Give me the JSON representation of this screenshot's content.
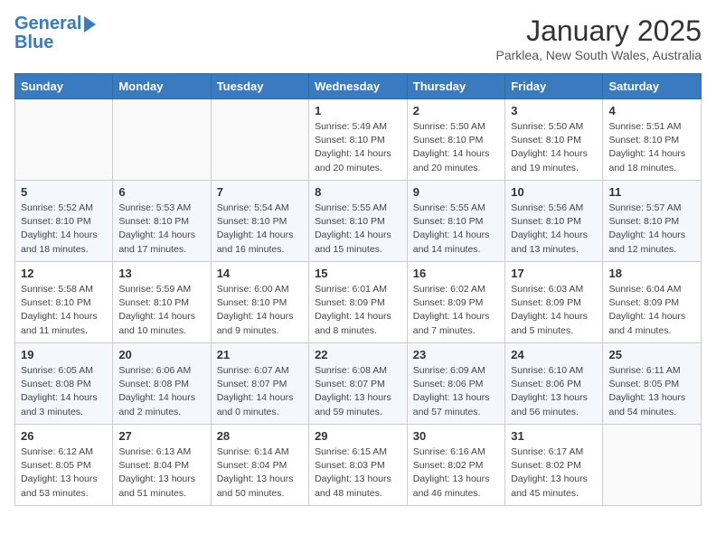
{
  "header": {
    "logo_line1": "General",
    "logo_line2": "Blue",
    "month": "January 2025",
    "location": "Parklea, New South Wales, Australia"
  },
  "weekdays": [
    "Sunday",
    "Monday",
    "Tuesday",
    "Wednesday",
    "Thursday",
    "Friday",
    "Saturday"
  ],
  "weeks": [
    [
      {
        "day": "",
        "info": ""
      },
      {
        "day": "",
        "info": ""
      },
      {
        "day": "",
        "info": ""
      },
      {
        "day": "1",
        "info": "Sunrise: 5:49 AM\nSunset: 8:10 PM\nDaylight: 14 hours\nand 20 minutes."
      },
      {
        "day": "2",
        "info": "Sunrise: 5:50 AM\nSunset: 8:10 PM\nDaylight: 14 hours\nand 20 minutes."
      },
      {
        "day": "3",
        "info": "Sunrise: 5:50 AM\nSunset: 8:10 PM\nDaylight: 14 hours\nand 19 minutes."
      },
      {
        "day": "4",
        "info": "Sunrise: 5:51 AM\nSunset: 8:10 PM\nDaylight: 14 hours\nand 18 minutes."
      }
    ],
    [
      {
        "day": "5",
        "info": "Sunrise: 5:52 AM\nSunset: 8:10 PM\nDaylight: 14 hours\nand 18 minutes."
      },
      {
        "day": "6",
        "info": "Sunrise: 5:53 AM\nSunset: 8:10 PM\nDaylight: 14 hours\nand 17 minutes."
      },
      {
        "day": "7",
        "info": "Sunrise: 5:54 AM\nSunset: 8:10 PM\nDaylight: 14 hours\nand 16 minutes."
      },
      {
        "day": "8",
        "info": "Sunrise: 5:55 AM\nSunset: 8:10 PM\nDaylight: 14 hours\nand 15 minutes."
      },
      {
        "day": "9",
        "info": "Sunrise: 5:55 AM\nSunset: 8:10 PM\nDaylight: 14 hours\nand 14 minutes."
      },
      {
        "day": "10",
        "info": "Sunrise: 5:56 AM\nSunset: 8:10 PM\nDaylight: 14 hours\nand 13 minutes."
      },
      {
        "day": "11",
        "info": "Sunrise: 5:57 AM\nSunset: 8:10 PM\nDaylight: 14 hours\nand 12 minutes."
      }
    ],
    [
      {
        "day": "12",
        "info": "Sunrise: 5:58 AM\nSunset: 8:10 PM\nDaylight: 14 hours\nand 11 minutes."
      },
      {
        "day": "13",
        "info": "Sunrise: 5:59 AM\nSunset: 8:10 PM\nDaylight: 14 hours\nand 10 minutes."
      },
      {
        "day": "14",
        "info": "Sunrise: 6:00 AM\nSunset: 8:10 PM\nDaylight: 14 hours\nand 9 minutes."
      },
      {
        "day": "15",
        "info": "Sunrise: 6:01 AM\nSunset: 8:09 PM\nDaylight: 14 hours\nand 8 minutes."
      },
      {
        "day": "16",
        "info": "Sunrise: 6:02 AM\nSunset: 8:09 PM\nDaylight: 14 hours\nand 7 minutes."
      },
      {
        "day": "17",
        "info": "Sunrise: 6:03 AM\nSunset: 8:09 PM\nDaylight: 14 hours\nand 5 minutes."
      },
      {
        "day": "18",
        "info": "Sunrise: 6:04 AM\nSunset: 8:09 PM\nDaylight: 14 hours\nand 4 minutes."
      }
    ],
    [
      {
        "day": "19",
        "info": "Sunrise: 6:05 AM\nSunset: 8:08 PM\nDaylight: 14 hours\nand 3 minutes."
      },
      {
        "day": "20",
        "info": "Sunrise: 6:06 AM\nSunset: 8:08 PM\nDaylight: 14 hours\nand 2 minutes."
      },
      {
        "day": "21",
        "info": "Sunrise: 6:07 AM\nSunset: 8:07 PM\nDaylight: 14 hours\nand 0 minutes."
      },
      {
        "day": "22",
        "info": "Sunrise: 6:08 AM\nSunset: 8:07 PM\nDaylight: 13 hours\nand 59 minutes."
      },
      {
        "day": "23",
        "info": "Sunrise: 6:09 AM\nSunset: 8:06 PM\nDaylight: 13 hours\nand 57 minutes."
      },
      {
        "day": "24",
        "info": "Sunrise: 6:10 AM\nSunset: 8:06 PM\nDaylight: 13 hours\nand 56 minutes."
      },
      {
        "day": "25",
        "info": "Sunrise: 6:11 AM\nSunset: 8:05 PM\nDaylight: 13 hours\nand 54 minutes."
      }
    ],
    [
      {
        "day": "26",
        "info": "Sunrise: 6:12 AM\nSunset: 8:05 PM\nDaylight: 13 hours\nand 53 minutes."
      },
      {
        "day": "27",
        "info": "Sunrise: 6:13 AM\nSunset: 8:04 PM\nDaylight: 13 hours\nand 51 minutes."
      },
      {
        "day": "28",
        "info": "Sunrise: 6:14 AM\nSunset: 8:04 PM\nDaylight: 13 hours\nand 50 minutes."
      },
      {
        "day": "29",
        "info": "Sunrise: 6:15 AM\nSunset: 8:03 PM\nDaylight: 13 hours\nand 48 minutes."
      },
      {
        "day": "30",
        "info": "Sunrise: 6:16 AM\nSunset: 8:02 PM\nDaylight: 13 hours\nand 46 minutes."
      },
      {
        "day": "31",
        "info": "Sunrise: 6:17 AM\nSunset: 8:02 PM\nDaylight: 13 hours\nand 45 minutes."
      },
      {
        "day": "",
        "info": ""
      }
    ]
  ]
}
